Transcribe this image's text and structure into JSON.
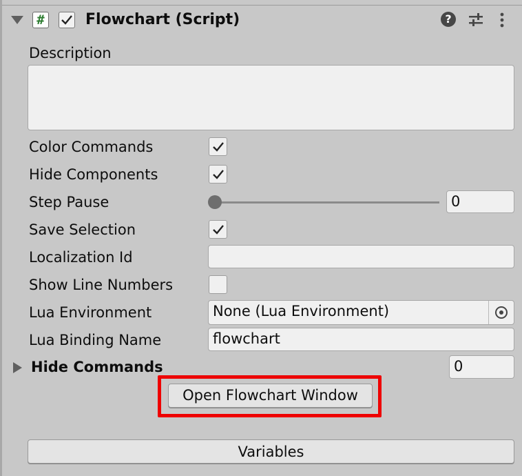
{
  "component": {
    "title": "Flowchart (Script)",
    "script_icon_glyph": "#",
    "enabled": true,
    "header_icons": [
      "help-icon",
      "presets-icon",
      "menu-icon"
    ]
  },
  "fields": {
    "description": {
      "label": "Description",
      "value": ""
    },
    "color_commands": {
      "label": "Color Commands",
      "checked": true
    },
    "hide_components": {
      "label": "Hide Components",
      "checked": true
    },
    "step_pause": {
      "label": "Step Pause",
      "value": "0"
    },
    "save_selection": {
      "label": "Save Selection",
      "checked": true
    },
    "localization_id": {
      "label": "Localization Id",
      "value": ""
    },
    "show_line_numbers": {
      "label": "Show Line Numbers",
      "checked": false
    },
    "lua_environment": {
      "label": "Lua Environment",
      "value": "None (Lua Environment)"
    },
    "lua_binding_name": {
      "label": "Lua Binding Name",
      "value": "flowchart"
    },
    "hide_commands": {
      "label": "Hide Commands",
      "count": "0",
      "expanded": false
    }
  },
  "buttons": {
    "open_flowchart_window": "Open Flowchart Window",
    "variables": "Variables"
  },
  "colors": {
    "panel_bg": "#c8c8c8",
    "field_bg": "#f0f0f0",
    "highlight": "#ee0000",
    "script_icon": "#2e7d32"
  }
}
